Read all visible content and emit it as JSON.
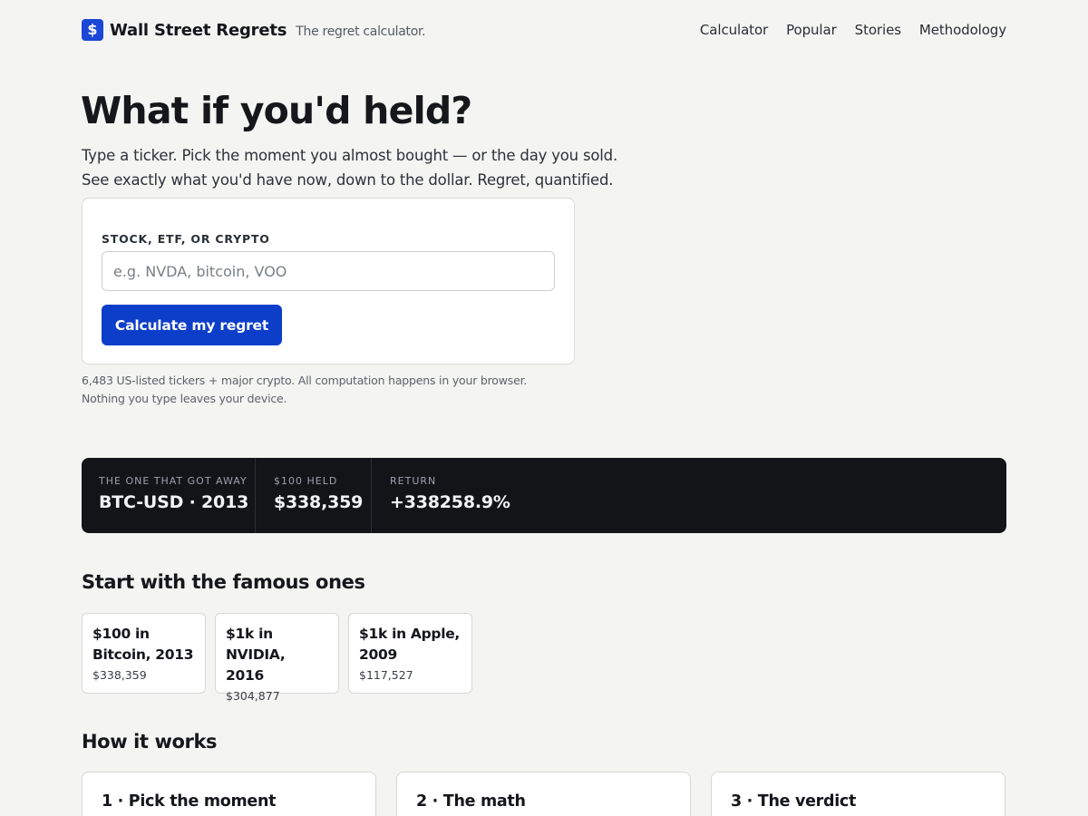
{
  "header": {
    "logo_glyph": "$",
    "brand": "Wall Street Regrets",
    "tagline": "The regret calculator.",
    "nav": [
      "Calculator",
      "Popular",
      "Stories",
      "Methodology"
    ]
  },
  "hero": {
    "title": "What if you'd held?",
    "subtitle_line1": "Type a ticker. Pick the moment you almost bought — or the day you sold.",
    "subtitle_line2": "See exactly what you'd have now, down to the dollar. Regret, quantified."
  },
  "form": {
    "label": "STOCK, ETF, OR CRYPTO",
    "value": "",
    "placeholder": "e.g. NVDA, bitcoin, VOO",
    "button": "Calculate my regret",
    "note_line1": "6,483 US-listed tickers + major crypto. All computation happens in your browser.",
    "note_line2": "Nothing you type leaves your device."
  },
  "banner": {
    "stats": [
      {
        "label": "THE ONE THAT GOT AWAY",
        "value": "BTC-USD · 2013"
      },
      {
        "label": "$100 HELD",
        "value": "$338,359"
      },
      {
        "label": "RETURN",
        "value": "+338258.9%"
      }
    ]
  },
  "famous": {
    "title": "Start with the famous ones",
    "cards": [
      {
        "line1": "$100 in",
        "line2": "Bitcoin, 2013",
        "value": "$338,359"
      },
      {
        "line1": "$1k in NVIDIA,",
        "line2": "2016",
        "value": "$304,877"
      },
      {
        "line1": "$1k in Apple,",
        "line2": "2009",
        "value": "$117,527"
      }
    ]
  },
  "how": {
    "title": "How it works",
    "steps": [
      "1 · Pick the moment",
      "2 · The math",
      "3 · The verdict"
    ]
  },
  "colors": {
    "accent": "#0d3ec9",
    "banner_bg": "#121418",
    "page_bg": "#f4f4f2"
  }
}
